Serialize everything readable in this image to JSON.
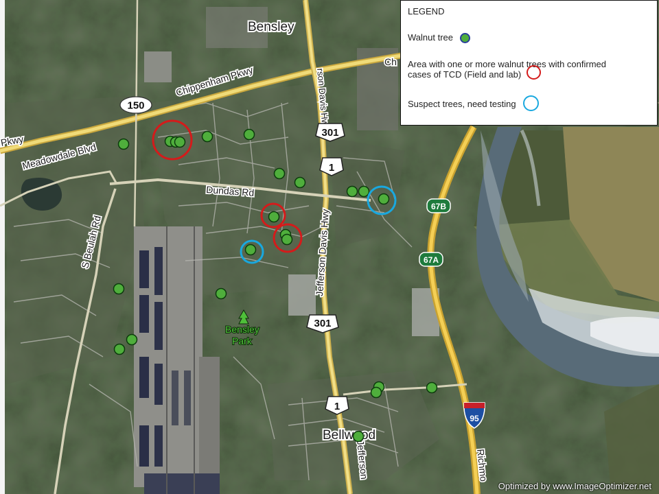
{
  "legend": {
    "title": "LEGEND",
    "walnut_label": "Walnut tree",
    "tcd_label_1": "Area with one or more walnut trees with confirmed",
    "tcd_label_2": "cases of TCD (Field and lab)",
    "suspect_label": "Suspect trees, need testing",
    "colors": {
      "walnut_fill": "#4fae3c",
      "walnut_outline": "#2a3f9a",
      "tcd": "#d41b1b",
      "suspect": "#19a8df"
    }
  },
  "map_labels": {
    "bensley": "Bensley",
    "bellwood": "Bellwood",
    "bensley_park_1": "Bensley",
    "bensley_park_2": "Park",
    "chippenham": "Chippenham Pkwy",
    "chippenham_right": "Ch",
    "meadowdale": "Meadowdale Blvd",
    "pkwy_left": "Pkwy",
    "dundas": "Dundas Rd",
    "beulah": "S Beulah Rd",
    "jeff_upper": "Jefferson Davis Hwy",
    "jeff_top": "rson Davis Hwy",
    "jeff_bottom": "Jefferson",
    "richmond": "Richmo"
  },
  "shields": {
    "route_150": "150",
    "route_301_a": "301",
    "route_301_b": "301",
    "route_1_a": "1",
    "route_1_b": "1",
    "interstate_95": "95",
    "exit_67b": "67B",
    "exit_67a": "67A"
  },
  "tree_count": 23,
  "tcd_area_count": 3,
  "suspect_count": 2,
  "watermark": "Optimized by www.ImageOptimizer.net"
}
